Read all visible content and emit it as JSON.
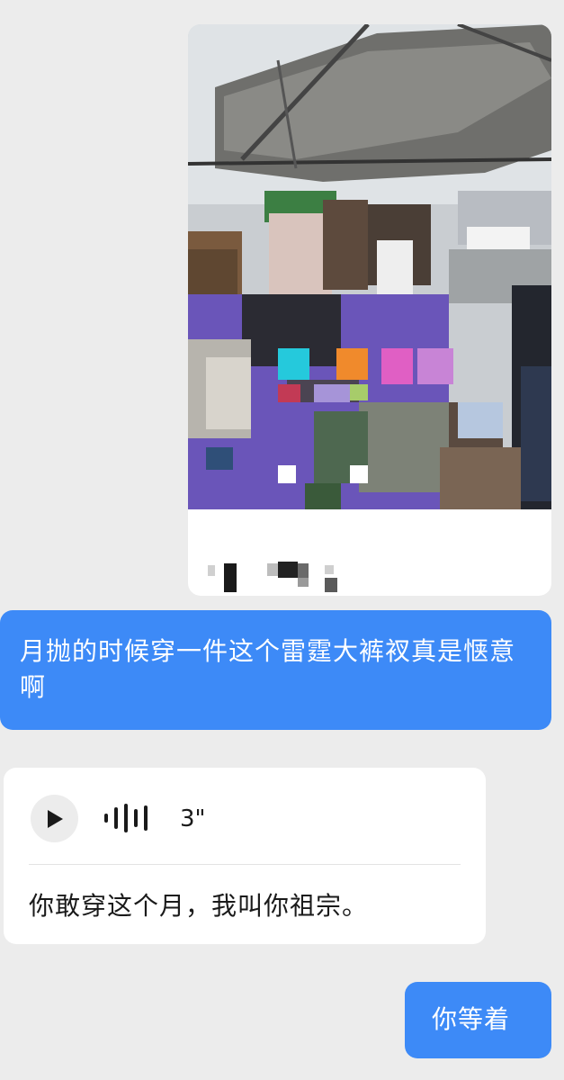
{
  "messages": {
    "image_message": {
      "icon": "photo-image",
      "content": "pixelated photo with blurred caption"
    },
    "sent_text": "月抛的时候穿一件这个雷霆大裤衩真是惬意啊",
    "voice_message": {
      "play_icon": "play-icon",
      "wave_icon": "waveform-icon",
      "duration": "3\"",
      "transcript": "你敢穿这个月，我叫你祖宗。"
    },
    "reply_text": "你等着"
  },
  "colors": {
    "background": "#ececec",
    "outgoing_bubble": "#3d8af7",
    "incoming_bubble": "#ffffff"
  }
}
